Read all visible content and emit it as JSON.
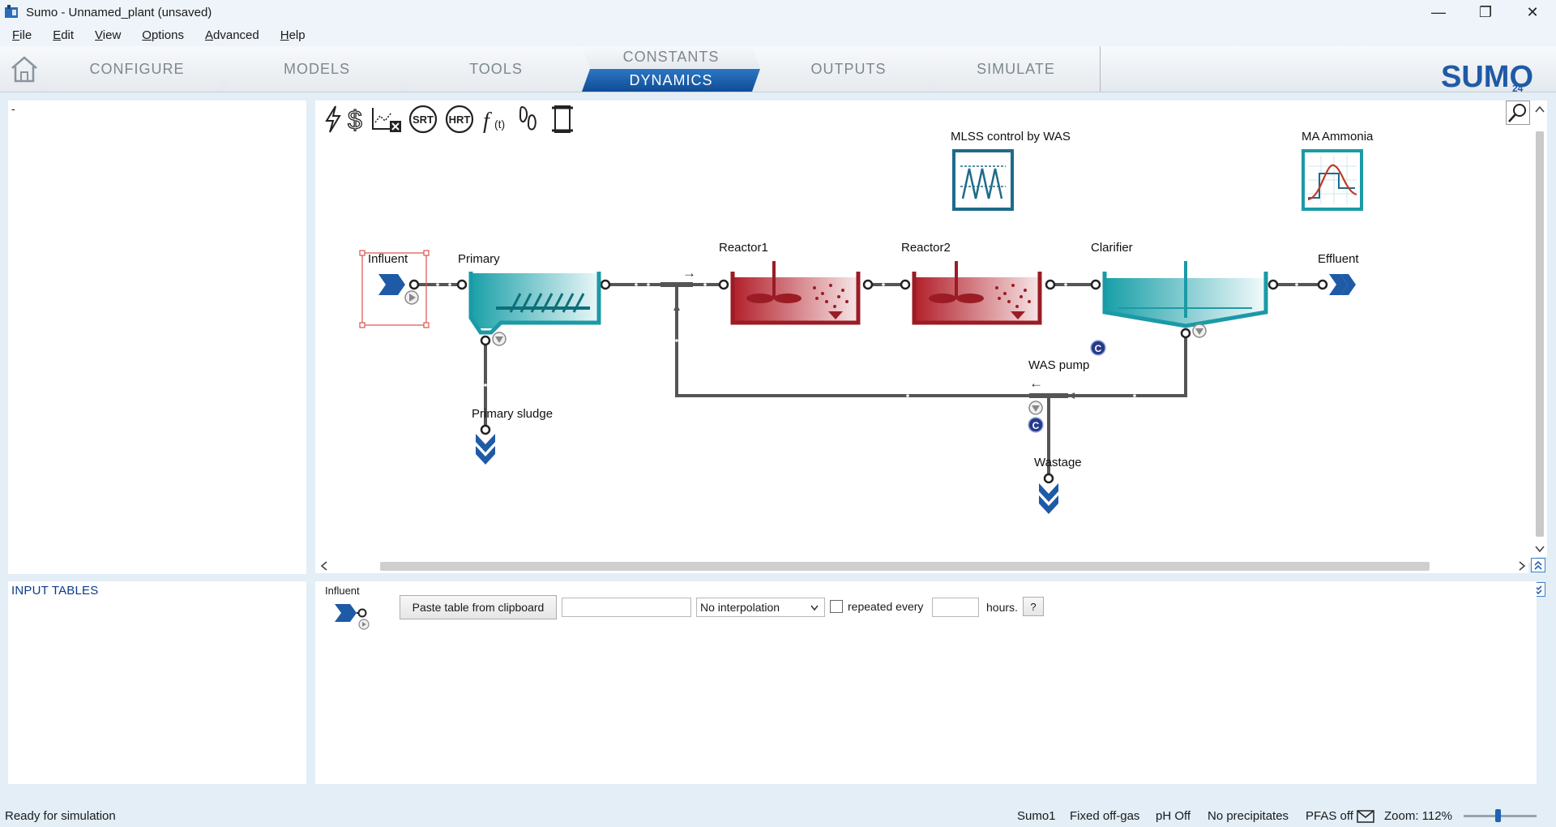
{
  "window": {
    "title": "Sumo - Unnamed_plant (unsaved)",
    "minimize_glyph": "—",
    "restore_glyph": "❐",
    "close_glyph": "✕"
  },
  "menu": [
    "File",
    "Edit",
    "View",
    "Options",
    "Advanced",
    "Help"
  ],
  "tabs": {
    "configure": "CONFIGURE",
    "models": "MODELS",
    "tools": "TOOLS",
    "constants": "CONSTANTS",
    "dynamics": "DYNAMICS",
    "outputs": "OUTPUTS",
    "simulate": "SIMULATE",
    "active": "DYNAMICS"
  },
  "brand": {
    "name": "SUMO",
    "version": "24"
  },
  "left_panel": {
    "text": "-"
  },
  "input_tables": {
    "title": "INPUT TABLES"
  },
  "toolbar_icons": [
    "lightning-icon",
    "dollar-icon",
    "chart-clear-icon",
    "srt-icon",
    "hrt-icon",
    "function-icon",
    "footprint-icon",
    "scroll-icon"
  ],
  "toolbar_text": {
    "srt": "SRT",
    "hrt": "HRT",
    "func": "f",
    "func_sub": "(t)"
  },
  "diagram": {
    "labels": {
      "influent": "Influent",
      "primary": "Primary",
      "reactor1": "Reactor1",
      "reactor2": "Reactor2",
      "clarifier": "Clarifier",
      "effluent": "Effluent",
      "primary_sludge": "Primary sludge",
      "was_pump": "WAS pump",
      "wastage": "Wastage",
      "mlss_control": "MLSS control by WAS",
      "ma_ammonia": "MA Ammonia"
    },
    "controller_badge": "C",
    "flow_arrow_right": "→",
    "flow_arrow_left": "←"
  },
  "input_row": {
    "element": "Influent",
    "paste_button": "Paste table from clipboard",
    "text_value": "",
    "interpolation": "No interpolation",
    "repeat_checked": false,
    "repeat_label": "repeated every",
    "hours_value": "",
    "hours_label": "hours.",
    "help_label": "?"
  },
  "status": {
    "left": "Ready for simulation",
    "model": "Sumo1",
    "offgas": "Fixed off-gas",
    "ph": "pH Off",
    "precip": "No precipitates",
    "pfas": "PFAS off",
    "zoom": "Zoom: 112%"
  },
  "colors": {
    "accent": "#1f5aa6",
    "teal": "#1b9aa6",
    "reactor_red": "#9b1c24",
    "background": "#e3eef6"
  }
}
